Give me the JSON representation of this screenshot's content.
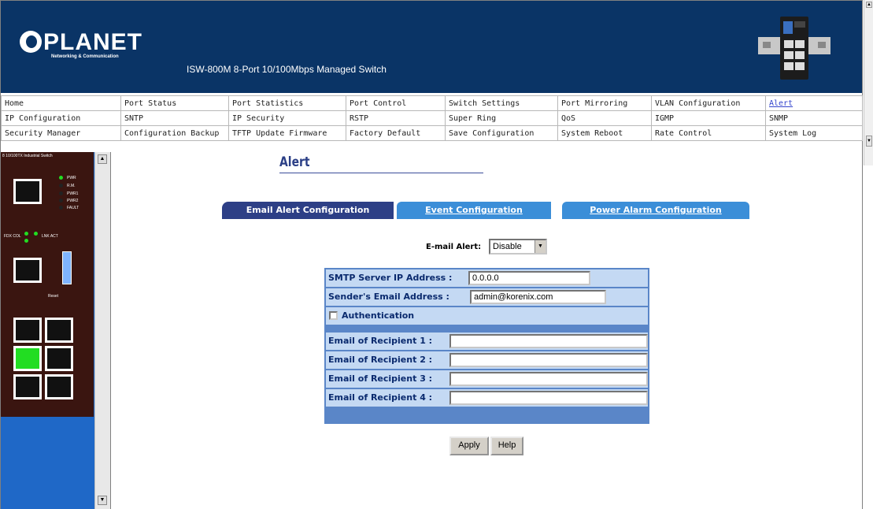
{
  "header": {
    "logo_text": "PLANET",
    "logo_tagline": "Networking & Communication",
    "product_title": "ISW-800M 8-Port 10/100Mbps Managed Switch"
  },
  "nav": {
    "rows": [
      [
        "Home",
        "Port Status",
        "Port Statistics",
        "Port Control",
        "Switch Settings",
        "Port Mirroring",
        "VLAN Configuration",
        "Alert"
      ],
      [
        "IP Configuration",
        "SNTP",
        "IP Security",
        "RSTP",
        "Super Ring",
        "QoS",
        "IGMP",
        "SNMP"
      ],
      [
        "Security Manager",
        "Configuration Backup",
        "TFTP Update Firmware",
        "Factory Default",
        "Save Configuration",
        "System Reboot",
        "Rate Control",
        "System Log"
      ]
    ],
    "active": "Alert"
  },
  "device": {
    "label": "8 10/100TX Industrial Switch",
    "leds": [
      "PWR",
      "R.M.",
      "PWR1",
      "PWR2",
      "FAULT"
    ],
    "fx_labels": [
      "FDX COL",
      "LNK ACT"
    ],
    "reset_label": "Reset"
  },
  "page": {
    "title": "Alert",
    "tabs": {
      "email": "Email Alert Configuration",
      "event": "Event Configuration",
      "power": "Power Alarm Configuration"
    },
    "email_alert": {
      "label": "E-mail Alert:",
      "value": "Disable"
    },
    "form": {
      "smtp_label": "SMTP Server IP Address :",
      "smtp_value": "0.0.0.0",
      "sender_label": "Sender's Email Address :",
      "sender_value": "admin@korenix.com",
      "auth_label": "Authentication",
      "recipient1_label": "Email of Recipient 1 :",
      "recipient2_label": "Email of Recipient 2 :",
      "recipient3_label": "Email of Recipient 3 :",
      "recipient4_label": "Email of Recipient 4 :"
    },
    "buttons": {
      "apply": "Apply",
      "help": "Help"
    }
  },
  "colors": {
    "banner": "#0a3466",
    "active_tab": "#2d3f86",
    "inactive_tab": "#3b8ed8",
    "table_border": "#5a86c8",
    "table_row": "#c4d9f3"
  }
}
